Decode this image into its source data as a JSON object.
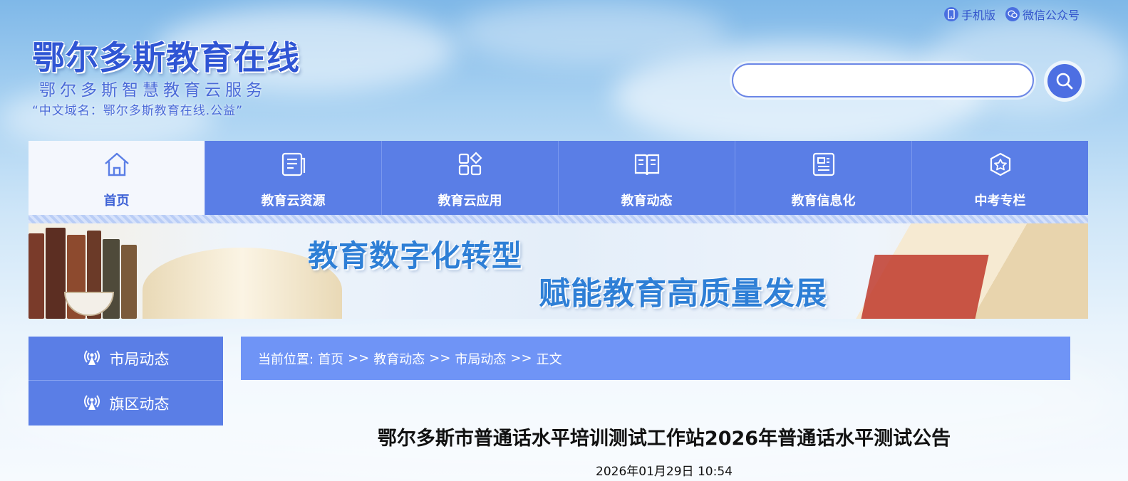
{
  "top_links": {
    "mobile": "手机版",
    "wechat": "微信公众号"
  },
  "logo": {
    "title": "鄂尔多斯教育在线",
    "subtitle": "鄂尔多斯智慧教育云服务",
    "domain": "“中文域名：鄂尔多斯教育在线.公益”"
  },
  "search": {
    "placeholder": "",
    "value": ""
  },
  "nav": {
    "items": [
      {
        "label": "首页",
        "icon": "home-icon"
      },
      {
        "label": "教育云资源",
        "icon": "document-icon"
      },
      {
        "label": "教育云应用",
        "icon": "apps-icon"
      },
      {
        "label": "教育动态",
        "icon": "book-icon"
      },
      {
        "label": "教育信息化",
        "icon": "info-icon"
      },
      {
        "label": "中考专栏",
        "icon": "badge-icon"
      }
    ]
  },
  "banner": {
    "line1": "教育数字化转型",
    "line2": "赋能教育高质量发展"
  },
  "sidebar": {
    "items": [
      {
        "label": "市局动态"
      },
      {
        "label": "旗区动态"
      }
    ]
  },
  "breadcrumb": {
    "prefix": "当前位置:",
    "items": [
      "首页",
      "教育动态",
      "市局动态",
      "正文"
    ],
    "sep": ">>"
  },
  "article": {
    "title": "鄂尔多斯市普通话水平培训测试工作站2026年普通话水平测试公告",
    "date": "2026年01月29日 10:54"
  },
  "colors": {
    "nav_bg": "#5a7ee6",
    "crumb_bg": "#6f94f6",
    "accent": "#2f55d4"
  }
}
